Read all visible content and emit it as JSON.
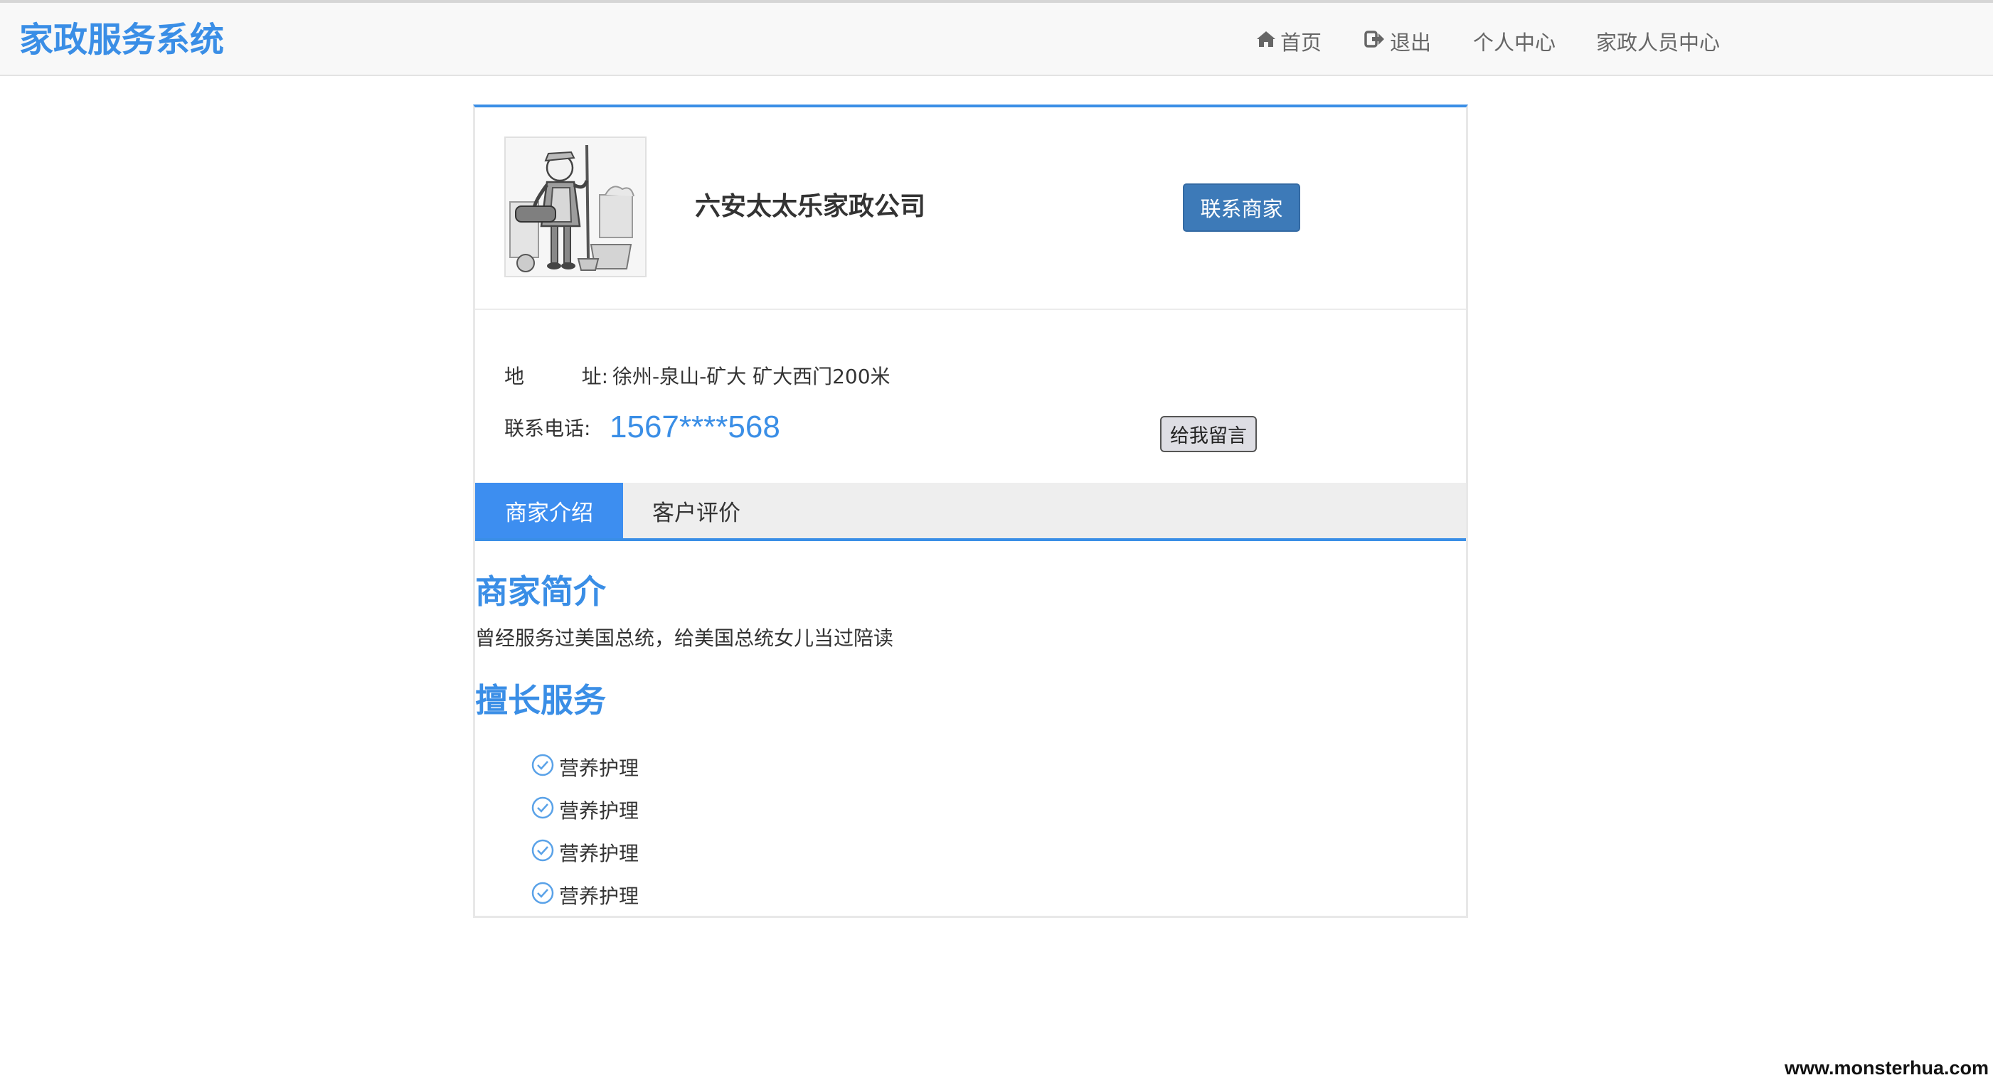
{
  "navbar": {
    "brand": "家政服务系统",
    "items": [
      {
        "label": "首页",
        "icon": "home-icon"
      },
      {
        "label": "退出",
        "icon": "logout-icon"
      },
      {
        "label": "个人中心"
      },
      {
        "label": "家政人员中心"
      }
    ]
  },
  "merchant": {
    "name": "六安太太乐家政公司",
    "contact_button": "联系商家",
    "address_label_1": "地",
    "address_label_2": "址:",
    "address": "徐州-泉山-矿大 矿大西门200米",
    "phone_label": "联系电话:",
    "phone": "1567****568",
    "message_button": "给我留言"
  },
  "tabs": [
    {
      "label": "商家介绍",
      "active": true
    },
    {
      "label": "客户评价",
      "active": false
    }
  ],
  "intro": {
    "title": "商家简介",
    "text": "曾经服务过美国总统，给美国总统女儿当过陪读"
  },
  "skills": {
    "title": "擅长服务",
    "items": [
      "营养护理",
      "营养护理",
      "营养护理",
      "营养护理"
    ]
  },
  "watermark": "www.monsterhua.com",
  "colors": {
    "accent": "#3a8ee6",
    "button": "#3d7ab8",
    "active_tab": "#3d8ef0"
  }
}
